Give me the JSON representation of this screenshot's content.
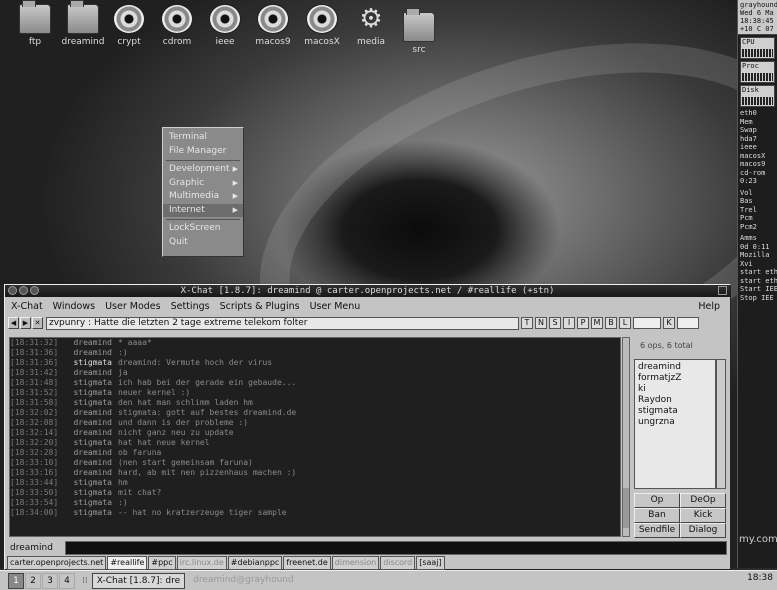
{
  "desktop": {
    "icons": [
      {
        "label": "ftp",
        "kind": "folder"
      },
      {
        "label": "dreamind",
        "kind": "folder"
      },
      {
        "label": "crypt",
        "kind": "disk"
      },
      {
        "label": "cdrom",
        "kind": "disk"
      },
      {
        "label": "ieee",
        "kind": "disk"
      },
      {
        "label": "macos9",
        "kind": "disk"
      },
      {
        "label": "macosX",
        "kind": "disk"
      },
      {
        "label": "media",
        "kind": "gear"
      },
      {
        "label": "src",
        "kind": "folder"
      }
    ]
  },
  "context_menu": {
    "items": [
      "Terminal",
      "File Manager",
      "Development",
      "Graphic",
      "Multimedia",
      "Internet",
      "LockScreen",
      "Quit"
    ]
  },
  "dock": {
    "header": "grayhound",
    "date": "Wed 6 Ma",
    "time": "18:38:45",
    "temp": "+10 C 07",
    "cpu_label": "CPU",
    "proc_label": "Proc",
    "disk_label": "Disk",
    "lines": [
      "eth0",
      "Mem",
      "Swap",
      "hda7",
      "ieee",
      "macosX",
      "macos9",
      "cd-rom",
      "0:23"
    ],
    "lines2": [
      "Vol",
      "Bas",
      "Trel",
      "Pcm",
      "Pcm2"
    ],
    "lines3": [
      "Amms",
      "0d 0:11",
      "Mozilla",
      "Xvi",
      "start eth",
      "start eth",
      "Start IEE",
      "Stop IEE"
    ],
    "site": "my.com",
    "clock": "18:38"
  },
  "xchat": {
    "title": "X-Chat [1.8.7]: dreamind @ carter.openprojects.net / #reallife (+stn)",
    "menu": [
      "X-Chat",
      "Windows",
      "User Modes",
      "Settings",
      "Scripts & Plugins",
      "User Menu"
    ],
    "help": "Help",
    "topic": "zvpunry : Hatte die letzten 2 tage extreme telekom folter",
    "modes": [
      "T",
      "N",
      "S",
      "I",
      "P",
      "M",
      "B",
      "L"
    ],
    "key_label": "K",
    "user_count": "6 ops, 6 total",
    "users": [
      "dreamind",
      "formatjzZ",
      "ki",
      "Raydon",
      "stigmata",
      "ungrzna"
    ],
    "buttons": [
      "Op",
      "DeOp",
      "Ban",
      "Kick",
      "Sendfile",
      "Dialog"
    ],
    "nick": "dreamind",
    "messages": [
      {
        "ts": "[18:31:32]",
        "nick": "dreamind",
        "text": "* aaaa*",
        "bold": false
      },
      {
        "ts": "[18:31:36]",
        "nick": "dreamind",
        "text": ":)",
        "bold": false
      },
      {
        "ts": "[18:31:36]",
        "nick": "stigmata",
        "text": "dreamind: Vermute hoch der virus",
        "bold": true
      },
      {
        "ts": "[18:31:42]",
        "nick": "dreamind",
        "text": "ja",
        "bold": false
      },
      {
        "ts": "[18:31:48]",
        "nick": "stigmata",
        "text": "ich hab bei der gerade ein gebaude...",
        "bold": false
      },
      {
        "ts": "[18:31:52]",
        "nick": "stigmata",
        "text": "neuer kernel :)",
        "bold": false
      },
      {
        "ts": "[18:31:58]",
        "nick": "stigmata",
        "text": "den hat man schlimm laden hm",
        "bold": false
      },
      {
        "ts": "[18:32:02]",
        "nick": "dreamind",
        "text": "stigmata: gott auf bestes dreamind.de",
        "bold": false
      },
      {
        "ts": "[18:32:08]",
        "nick": "dreamind",
        "text": "und dann is der probleme :)",
        "bold": false
      },
      {
        "ts": "[18:32:14]",
        "nick": "dreamind",
        "text": "nicht ganz neu zu update",
        "bold": false
      },
      {
        "ts": "[18:32:20]",
        "nick": "stigmata",
        "text": "hat hat neue kernel",
        "bold": false
      },
      {
        "ts": "[18:32:28]",
        "nick": "dreamind",
        "text": "ob faruna",
        "bold": false
      },
      {
        "ts": "[18:33:10]",
        "nick": "dreamind",
        "text": "(nen start gemeinsam faruna)",
        "bold": false
      },
      {
        "ts": "[18:33:16]",
        "nick": "dreamind",
        "text": "hard, ab mit nen pizzenhaus machen :)",
        "bold": false
      },
      {
        "ts": "[18:33:44]",
        "nick": "stigmata",
        "text": "hm",
        "bold": false
      },
      {
        "ts": "[18:33:50]",
        "nick": "stigmata",
        "text": "mit chat?",
        "bold": false
      },
      {
        "ts": "[18:33:54]",
        "nick": "stigmata",
        "text": ":)",
        "bold": false
      },
      {
        "ts": "[18:34:00]",
        "nick": "stigmata",
        "text": "-- hat no kratzerzeuge tiger sample",
        "bold": false
      }
    ],
    "tabs": [
      {
        "label": "carter.openprojects.net",
        "state": "normal"
      },
      {
        "label": "#reallife",
        "state": "active"
      },
      {
        "label": "#ppc",
        "state": "normal"
      },
      {
        "label": "irc.linux.de",
        "state": "dim"
      },
      {
        "label": "#debianppc",
        "state": "normal"
      },
      {
        "label": "freenet.de",
        "state": "normal"
      },
      {
        "label": "dimension",
        "state": "dim"
      },
      {
        "label": "discord",
        "state": "dim"
      },
      {
        "label": "[saaj]",
        "state": "normal"
      }
    ]
  },
  "taskbar": {
    "workspaces": [
      "1",
      "2",
      "3",
      "4"
    ],
    "active_workspace": "1",
    "tasks": [
      {
        "label": "X-Chat [1.8.7]: dre",
        "state": "current"
      },
      {
        "label": "dreamind@grayhound",
        "state": "other"
      }
    ],
    "clock": "18:38"
  }
}
